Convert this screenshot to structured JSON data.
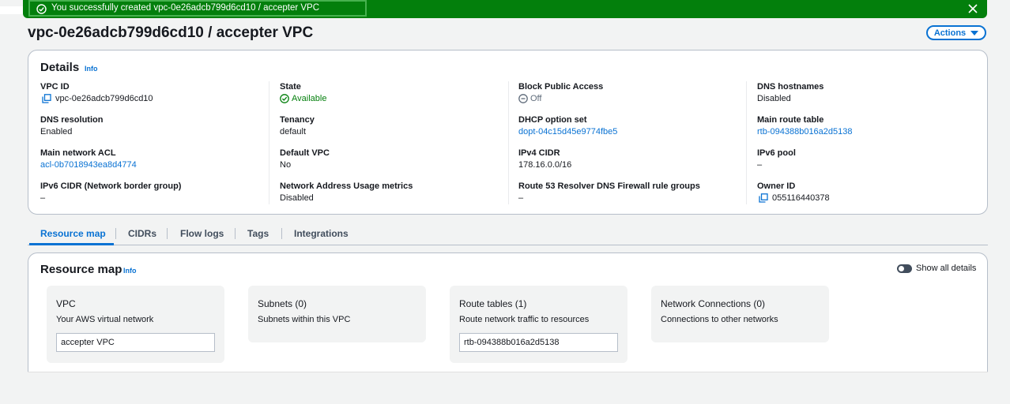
{
  "flash": {
    "message": "You successfully created vpc-0e26adcb799d6cd10 / accepter VPC",
    "color": "#037f0c"
  },
  "page": {
    "title": "vpc-0e26adcb799d6cd10 / accepter VPC",
    "actions_label": "Actions"
  },
  "details": {
    "heading": "Details",
    "info_label": "Info",
    "vpc_id": {
      "label": "VPC ID",
      "value": "vpc-0e26adcb799d6cd10"
    },
    "state": {
      "label": "State",
      "value": "Available"
    },
    "block_public_access": {
      "label": "Block Public Access",
      "value": "Off"
    },
    "dns_hostnames": {
      "label": "DNS hostnames",
      "value": "Disabled"
    },
    "dns_resolution": {
      "label": "DNS resolution",
      "value": "Enabled"
    },
    "tenancy": {
      "label": "Tenancy",
      "value": "default"
    },
    "dhcp_option_set": {
      "label": "DHCP option set",
      "value": "dopt-04c15d45e9774fbe5"
    },
    "main_route_table": {
      "label": "Main route table",
      "value": "rtb-094388b016a2d5138"
    },
    "main_network_acl": {
      "label": "Main network ACL",
      "value": "acl-0b7018943ea8d4774"
    },
    "default_vpc": {
      "label": "Default VPC",
      "value": "No"
    },
    "ipv4_cidr": {
      "label": "IPv4 CIDR",
      "value": "178.16.0.0/16"
    },
    "ipv6_pool": {
      "label": "IPv6 pool",
      "value": "–"
    },
    "ipv6_cidr": {
      "label": "IPv6 CIDR (Network border group)",
      "value": "–"
    },
    "nau_metrics": {
      "label": "Network Address Usage metrics",
      "value": "Disabled"
    },
    "route53_fw": {
      "label": "Route 53 Resolver DNS Firewall rule groups",
      "value": "–"
    },
    "owner_id": {
      "label": "Owner ID",
      "value": "055116440378"
    }
  },
  "tabs": [
    {
      "label": "Resource map"
    },
    {
      "label": "CIDRs"
    },
    {
      "label": "Flow logs"
    },
    {
      "label": "Tags"
    },
    {
      "label": "Integrations"
    }
  ],
  "resource_map": {
    "heading": "Resource map",
    "info_label": "Info",
    "toggle_label": "Show all details",
    "boxes": [
      {
        "title": "VPC",
        "subtitle": "Your AWS virtual network",
        "item": "accepter VPC"
      },
      {
        "title": "Subnets (0)",
        "subtitle": "Subnets within this VPC"
      },
      {
        "title": "Route tables (1)",
        "subtitle": "Route network traffic to resources",
        "item": "rtb-094388b016a2d5138"
      },
      {
        "title": "Network Connections (0)",
        "subtitle": "Connections to other networks"
      }
    ]
  }
}
